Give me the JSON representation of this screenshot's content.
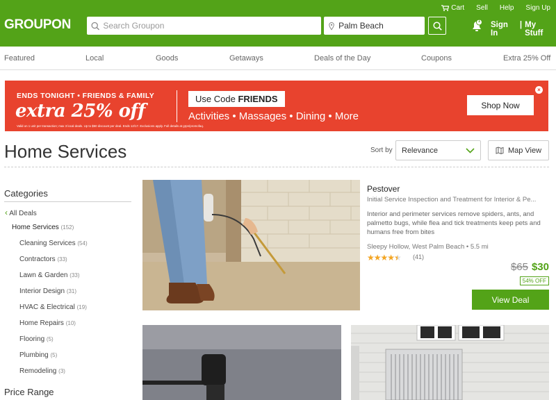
{
  "header": {
    "logo": "GROUPON",
    "top_links": [
      "Cart",
      "Sell",
      "Help",
      "Sign Up"
    ],
    "search_placeholder": "Search Groupon",
    "location_value": "Palm Beach",
    "notification_count": "1",
    "sign_in": "Sign In",
    "separator": "|",
    "my_stuff": "My Stuff"
  },
  "nav": [
    "Featured",
    "Local",
    "Goods",
    "Getaways",
    "Deals of the Day",
    "Coupons",
    "Extra 25% Off"
  ],
  "banner": {
    "line1": "ENDS TONIGHT • FRIENDS & FAMILY",
    "line2": "extra 25% off",
    "fine_print": "Valid on 1 unit per transaction; max 3 local deals. Up to $50 discount per deal. Ends 12/17. Exclusions apply. Full details at grpn/promofaq.",
    "code_prefix": "Use Code",
    "code": "FRIENDS",
    "categories": "Activities • Massages • Dining • More",
    "cta": "Shop Now",
    "close": "×"
  },
  "page": {
    "title": "Home Services",
    "sort_label": "Sort by",
    "sort_value": "Relevance",
    "map_view": "Map View"
  },
  "sidebar": {
    "categories_heading": "Categories",
    "all_deals": "All Deals",
    "parent": {
      "label": "Home Services",
      "count": "(152)"
    },
    "items": [
      {
        "label": "Cleaning Services",
        "count": "(54)"
      },
      {
        "label": "Contractors",
        "count": "(33)"
      },
      {
        "label": "Lawn & Garden",
        "count": "(33)"
      },
      {
        "label": "Interior Design",
        "count": "(31)"
      },
      {
        "label": "HVAC & Electrical",
        "count": "(19)"
      },
      {
        "label": "Home Repairs",
        "count": "(10)"
      },
      {
        "label": "Flooring",
        "count": "(5)"
      },
      {
        "label": "Plumbing",
        "count": "(5)"
      },
      {
        "label": "Remodeling",
        "count": "(3)"
      }
    ],
    "price_heading": "Price Range"
  },
  "deal": {
    "title": "Pestover",
    "subtitle": "Initial Service Inspection and Treatment for Interior & Pe...",
    "description": "Interior and perimeter services remove spiders, ants, and palmetto bugs, while flea and tick treatments keep pets and humans free from bites",
    "location": "Sleepy Hollow, West Palm Beach",
    "distance": "• 5.5 mi",
    "rating": 4.5,
    "stars": "★★★★★",
    "reviews": "(41)",
    "old_price": "$65",
    "price": "$30",
    "discount": "54% OFF",
    "cta": "View Deal"
  },
  "colors": {
    "brand": "#53a318",
    "banner": "#e8432e"
  }
}
